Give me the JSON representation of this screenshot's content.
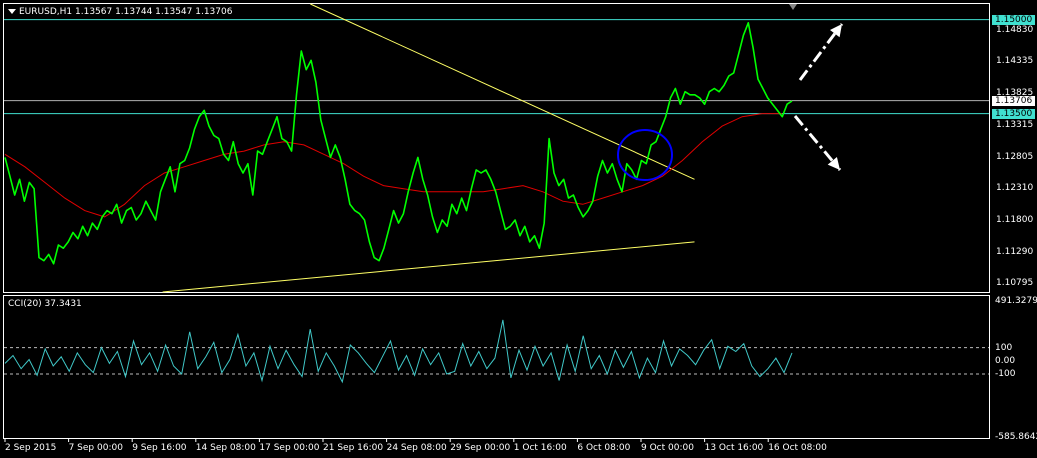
{
  "header": {
    "symbol_tf": "EURUSD,H1",
    "ohlc": "1.13567 1.13744 1.13547 1.13706"
  },
  "cci_header": {
    "label": "CCI(20) 37.3431"
  },
  "colors": {
    "background": "#000000",
    "price": "#00ff00",
    "ma": "#e00000",
    "trendline": "#ffff66",
    "hline": "#40e0d0",
    "current_line": "#b0b0b0",
    "cci": "#40c8c8",
    "circle": "#0000ff",
    "arrow": "#ffffff"
  },
  "price_axis": {
    "ticks": [
      "1.14830",
      "1.14335",
      "1.13825",
      "1.13315",
      "1.12805",
      "1.12310",
      "1.11800",
      "1.11290",
      "1.10795"
    ],
    "tags": [
      {
        "value": "1.15000",
        "bg": "#40e0d0",
        "fg": "#000000"
      },
      {
        "value": "1.13706",
        "bg": "#ffffff",
        "fg": "#000000"
      },
      {
        "value": "1.13500",
        "bg": "#40e0d0",
        "fg": "#000000"
      }
    ]
  },
  "cci_axis": {
    "ticks": [
      "491.3279",
      "100",
      "0.00",
      "-100",
      "-585.8642"
    ]
  },
  "time_axis": {
    "labels": [
      "2 Sep 2015",
      "7 Sep 00:00",
      "9 Sep 16:00",
      "14 Sep 08:00",
      "17 Sep 00:00",
      "21 Sep 16:00",
      "24 Sep 08:00",
      "29 Sep 00:00",
      "1 Oct 16:00",
      "6 Oct 08:00",
      "9 Oct 00:00",
      "13 Oct 16:00",
      "16 Oct 08:00"
    ]
  },
  "chart_data": {
    "type": "line",
    "price_range": [
      1.1065,
      1.1525
    ],
    "cci_range": [
      -585.8642,
      491.3279
    ],
    "price_series": {
      "name": "EURUSD,H1",
      "values": [
        1.128,
        1.125,
        1.122,
        1.1245,
        1.121,
        1.124,
        1.123,
        1.112,
        1.1115,
        1.1125,
        1.111,
        1.114,
        1.1135,
        1.1145,
        1.116,
        1.115,
        1.117,
        1.1155,
        1.1175,
        1.1165,
        1.1185,
        1.1195,
        1.119,
        1.1205,
        1.1175,
        1.1195,
        1.12,
        1.118,
        1.119,
        1.121,
        1.1195,
        1.118,
        1.1225,
        1.1245,
        1.1265,
        1.1225,
        1.127,
        1.1275,
        1.1295,
        1.1325,
        1.1345,
        1.1355,
        1.133,
        1.1315,
        1.131,
        1.1285,
        1.1275,
        1.1305,
        1.127,
        1.1255,
        1.127,
        1.122,
        1.129,
        1.1285,
        1.1305,
        1.1325,
        1.1345,
        1.131,
        1.1305,
        1.129,
        1.138,
        1.145,
        1.142,
        1.1435,
        1.14,
        1.134,
        1.131,
        1.128,
        1.13,
        1.128,
        1.1245,
        1.1205,
        1.1195,
        1.119,
        1.118,
        1.1145,
        1.112,
        1.1115,
        1.1135,
        1.1165,
        1.1195,
        1.1175,
        1.119,
        1.1225,
        1.1255,
        1.128,
        1.1245,
        1.122,
        1.1185,
        1.116,
        1.118,
        1.117,
        1.1205,
        1.119,
        1.1215,
        1.1195,
        1.123,
        1.126,
        1.1255,
        1.126,
        1.1245,
        1.1225,
        1.1195,
        1.1165,
        1.117,
        1.118,
        1.1155,
        1.117,
        1.1145,
        1.1155,
        1.1135,
        1.1175,
        1.131,
        1.1255,
        1.1235,
        1.1245,
        1.1215,
        1.122,
        1.12,
        1.1185,
        1.1195,
        1.121,
        1.125,
        1.1275,
        1.1255,
        1.127,
        1.1245,
        1.1225,
        1.127,
        1.126,
        1.1245,
        1.1275,
        1.127,
        1.13,
        1.1305,
        1.1325,
        1.1345,
        1.1375,
        1.139,
        1.1365,
        1.1385,
        1.138,
        1.138,
        1.1375,
        1.1365,
        1.1385,
        1.139,
        1.1385,
        1.1395,
        1.141,
        1.1415,
        1.1445,
        1.1475,
        1.1495,
        1.1455,
        1.1405,
        1.139,
        1.1375,
        1.1365,
        1.1355,
        1.1345,
        1.1365,
        1.137
      ],
      "color": "#00ff00"
    },
    "ma_series": {
      "name": "",
      "values": [
        1.1285,
        1.1265,
        1.124,
        1.1215,
        1.1195,
        1.1185,
        1.1205,
        1.1235,
        1.1255,
        1.1265,
        1.1275,
        1.1285,
        1.129,
        1.13,
        1.1305,
        1.13,
        1.1285,
        1.127,
        1.125,
        1.1235,
        1.123,
        1.1225,
        1.1225,
        1.1225,
        1.1225,
        1.123,
        1.1235,
        1.1225,
        1.121,
        1.1205,
        1.1215,
        1.1225,
        1.1235,
        1.125,
        1.1275,
        1.1305,
        1.133,
        1.1345,
        1.135,
        1.135
      ],
      "color": "#e00000"
    },
    "cci_series": {
      "name": "CCI(20)",
      "values": [
        -20,
        40,
        -60,
        10,
        -110,
        90,
        -40,
        30,
        -80,
        60,
        -30,
        -90,
        100,
        -20,
        70,
        -120,
        150,
        -30,
        60,
        -80,
        120,
        -40,
        -100,
        220,
        -60,
        30,
        140,
        -90,
        10,
        200,
        -40,
        60,
        -150,
        110,
        -60,
        80,
        -30,
        -120,
        240,
        -80,
        60,
        -40,
        -160,
        120,
        60,
        -20,
        -90,
        30,
        150,
        -70,
        40,
        -110,
        90,
        -30,
        60,
        -100,
        -80,
        130,
        -40,
        70,
        -60,
        20,
        310,
        -130,
        80,
        -70,
        110,
        -40,
        60,
        -150,
        120,
        -80,
        190,
        -60,
        40,
        -100,
        80,
        -50,
        70,
        -130,
        20,
        -90,
        150,
        -40,
        90,
        40,
        -30,
        80,
        160,
        -60,
        110,
        70,
        130,
        -40,
        -120,
        -60,
        20,
        -90,
        60
      ],
      "color": "#40c8c8"
    },
    "resistance_line": {
      "value": 1.15,
      "label": "1.15000"
    },
    "support_line": {
      "value": 1.135,
      "label": "1.13500"
    },
    "current_price": {
      "value": 1.13706,
      "label": "1.13706"
    },
    "trendlines": [
      {
        "name": "descending",
        "from": [
          0.31,
          1.1525
        ],
        "to": [
          0.7,
          1.1245
        ]
      },
      {
        "name": "ascending",
        "from": [
          0.16,
          1.1065
        ],
        "to": [
          0.7,
          1.1145
        ]
      }
    ]
  }
}
